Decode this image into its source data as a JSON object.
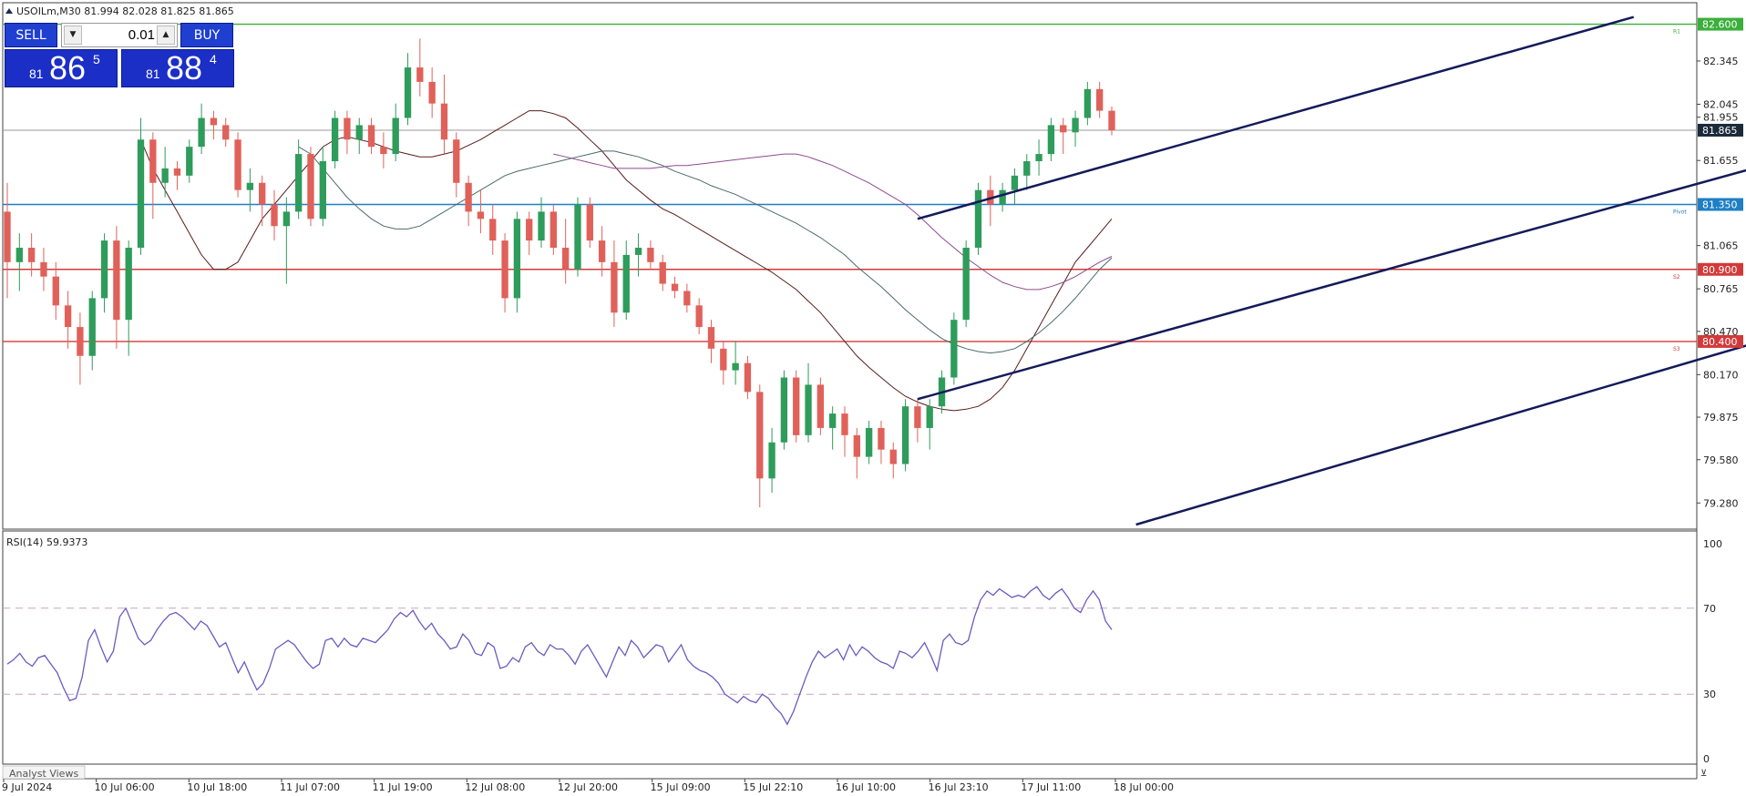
{
  "symbol_header": "USOILm,M30  81.994 82.028 81.825 81.865",
  "trade_panel": {
    "sell_label": "SELL",
    "buy_label": "BUY",
    "lot": "0.01",
    "bid": {
      "small": "81",
      "big": "86",
      "sup": "5"
    },
    "ask": {
      "small": "81",
      "big": "88",
      "sup": "4"
    }
  },
  "price_axis": {
    "min": 79.13,
    "max": 82.73,
    "ticks": [
      "82.345",
      "82.045",
      "81.955",
      "81.655",
      "81.065",
      "80.765",
      "80.470",
      "80.170",
      "79.875",
      "79.580",
      "79.280"
    ],
    "current_price": "81.865"
  },
  "levels": [
    {
      "price": 82.6,
      "label": "82.600",
      "color": "#3aaf3a",
      "tag": "R1"
    },
    {
      "price": 81.35,
      "label": "81.350",
      "color": "#1e7fc4",
      "tag": "Pivot"
    },
    {
      "price": 80.9,
      "label": "80.900",
      "color": "#d23a3a",
      "tag": "S2"
    },
    {
      "price": 80.4,
      "label": "80.400",
      "color": "#d23a3a",
      "tag": "S3"
    }
  ],
  "channel_lines": [
    {
      "x1": 75,
      "y1": 81.25,
      "x2": 134,
      "y2": 82.65
    },
    {
      "x1": 75,
      "y1": 80.0,
      "x2": 189,
      "y2": 82.65
    },
    {
      "x1": 93,
      "y1": 79.13,
      "x2": 189,
      "y2": 81.5
    }
  ],
  "time_axis": {
    "labels": [
      "9 Jul 2024",
      "10 Jul 06:00",
      "10 Jul 18:00",
      "11 Jul 07:00",
      "11 Jul 19:00",
      "12 Jul 08:00",
      "12 Jul 20:00",
      "15 Jul 09:00",
      "15 Jul 22:10",
      "16 Jul 10:00",
      "16 Jul 23:10",
      "17 Jul 11:00",
      "18 Jul 00:00"
    ]
  },
  "rsi": {
    "label": "RSI(14) 59.9373",
    "levels": [
      "100",
      "70",
      "30",
      "0"
    ],
    "color": "#6b5bbf"
  },
  "bottom_tab": "Analyst Views",
  "chart_data": {
    "type": "candlestick",
    "title": "USOILm,M30",
    "ylim": [
      79.13,
      82.73
    ],
    "candles": [
      [
        81.3,
        81.5,
        80.7,
        80.95
      ],
      [
        80.95,
        81.15,
        80.75,
        81.05
      ],
      [
        81.05,
        81.15,
        80.85,
        80.95
      ],
      [
        80.95,
        81.05,
        80.75,
        80.85
      ],
      [
        80.85,
        80.95,
        80.55,
        80.65
      ],
      [
        80.65,
        80.75,
        80.35,
        80.5
      ],
      [
        80.5,
        80.6,
        80.1,
        80.3
      ],
      [
        80.3,
        80.75,
        80.2,
        80.7
      ],
      [
        80.7,
        81.15,
        80.6,
        81.1
      ],
      [
        81.1,
        81.2,
        80.35,
        80.55
      ],
      [
        80.55,
        81.1,
        80.3,
        81.05
      ],
      [
        81.05,
        81.95,
        81.0,
        81.8
      ],
      [
        81.8,
        81.85,
        81.25,
        81.5
      ],
      [
        81.5,
        81.75,
        81.4,
        81.6
      ],
      [
        81.6,
        81.65,
        81.45,
        81.55
      ],
      [
        81.55,
        81.8,
        81.5,
        81.75
      ],
      [
        81.75,
        82.05,
        81.7,
        81.95
      ],
      [
        81.95,
        82.0,
        81.8,
        81.9
      ],
      [
        81.9,
        81.95,
        81.75,
        81.8
      ],
      [
        81.8,
        81.85,
        81.4,
        81.45
      ],
      [
        81.45,
        81.6,
        81.3,
        81.5
      ],
      [
        81.5,
        81.55,
        81.2,
        81.35
      ],
      [
        81.35,
        81.45,
        81.1,
        81.2
      ],
      [
        81.2,
        81.4,
        80.8,
        81.3
      ],
      [
        81.3,
        81.8,
        81.25,
        81.7
      ],
      [
        81.7,
        81.75,
        81.2,
        81.25
      ],
      [
        81.25,
        81.75,
        81.2,
        81.65
      ],
      [
        81.65,
        82.0,
        81.6,
        81.95
      ],
      [
        81.95,
        82.0,
        81.7,
        81.8
      ],
      [
        81.8,
        81.95,
        81.7,
        81.9
      ],
      [
        81.9,
        81.95,
        81.7,
        81.75
      ],
      [
        81.75,
        81.85,
        81.6,
        81.7
      ],
      [
        81.7,
        82.05,
        81.65,
        81.95
      ],
      [
        81.95,
        82.4,
        81.9,
        82.3
      ],
      [
        82.3,
        82.5,
        82.1,
        82.2
      ],
      [
        82.2,
        82.3,
        81.95,
        82.05
      ],
      [
        82.05,
        82.25,
        81.7,
        81.8
      ],
      [
        81.8,
        81.85,
        81.4,
        81.5
      ],
      [
        81.5,
        81.55,
        81.2,
        81.3
      ],
      [
        81.3,
        81.45,
        81.15,
        81.25
      ],
      [
        81.25,
        81.35,
        81.0,
        81.1
      ],
      [
        81.1,
        81.15,
        80.6,
        80.7
      ],
      [
        80.7,
        81.3,
        80.6,
        81.25
      ],
      [
        81.25,
        81.3,
        81.0,
        81.1
      ],
      [
        81.1,
        81.4,
        81.05,
        81.3
      ],
      [
        81.3,
        81.35,
        81.0,
        81.05
      ],
      [
        81.05,
        81.25,
        80.8,
        80.9
      ],
      [
        80.9,
        81.4,
        80.85,
        81.35
      ],
      [
        81.35,
        81.4,
        81.05,
        81.1
      ],
      [
        81.1,
        81.2,
        80.85,
        80.95
      ],
      [
        80.95,
        81.1,
        80.5,
        80.6
      ],
      [
        80.6,
        81.1,
        80.55,
        81.0
      ],
      [
        81.0,
        81.15,
        80.85,
        81.05
      ],
      [
        81.05,
        81.1,
        80.9,
        80.95
      ],
      [
        80.95,
        81.0,
        80.75,
        80.8
      ],
      [
        80.8,
        80.85,
        80.7,
        80.75
      ],
      [
        80.75,
        80.8,
        80.6,
        80.65
      ],
      [
        80.65,
        80.7,
        80.45,
        80.5
      ],
      [
        80.5,
        80.55,
        80.25,
        80.35
      ],
      [
        80.35,
        80.4,
        80.1,
        80.2
      ],
      [
        80.2,
        80.4,
        80.1,
        80.25
      ],
      [
        80.25,
        80.3,
        80.0,
        80.05
      ],
      [
        80.05,
        80.1,
        79.25,
        79.45
      ],
      [
        79.45,
        79.8,
        79.35,
        79.7
      ],
      [
        79.7,
        80.2,
        79.65,
        80.15
      ],
      [
        80.15,
        80.2,
        79.7,
        79.75
      ],
      [
        79.75,
        80.25,
        79.7,
        80.1
      ],
      [
        80.1,
        80.15,
        79.75,
        79.8
      ],
      [
        79.8,
        79.95,
        79.65,
        79.9
      ],
      [
        79.9,
        79.95,
        79.6,
        79.75
      ],
      [
        79.75,
        79.8,
        79.45,
        79.6
      ],
      [
        79.6,
        79.85,
        79.55,
        79.8
      ],
      [
        79.8,
        79.85,
        79.55,
        79.65
      ],
      [
        79.65,
        79.7,
        79.45,
        79.55
      ],
      [
        79.55,
        80.0,
        79.5,
        79.95
      ],
      [
        79.95,
        80.0,
        79.7,
        79.8
      ],
      [
        79.8,
        80.0,
        79.65,
        79.95
      ],
      [
        79.95,
        80.2,
        79.9,
        80.15
      ],
      [
        80.15,
        80.6,
        80.1,
        80.55
      ],
      [
        80.55,
        81.1,
        80.5,
        81.05
      ],
      [
        81.05,
        81.5,
        81.0,
        81.45
      ],
      [
        81.45,
        81.55,
        81.2,
        81.35
      ],
      [
        81.35,
        81.5,
        81.3,
        81.45
      ],
      [
        81.45,
        81.6,
        81.35,
        81.55
      ],
      [
        81.55,
        81.7,
        81.45,
        81.65
      ],
      [
        81.65,
        81.8,
        81.55,
        81.7
      ],
      [
        81.7,
        81.95,
        81.65,
        81.9
      ],
      [
        81.9,
        81.95,
        81.7,
        81.85
      ],
      [
        81.85,
        82.0,
        81.75,
        81.95
      ],
      [
        81.95,
        82.2,
        81.9,
        82.15
      ],
      [
        82.15,
        82.2,
        81.95,
        82.0
      ],
      [
        82.0,
        82.03,
        81.83,
        81.865
      ]
    ],
    "moving_averages": [
      {
        "color": "#5a1a1a",
        "values": [
          81.8,
          81.6,
          81.45,
          81.3,
          81.15,
          81.0,
          80.9,
          80.9,
          80.95,
          81.1,
          81.25,
          81.35,
          81.45,
          81.55,
          81.65,
          81.75,
          81.8,
          81.82,
          81.8,
          81.78,
          81.75,
          81.72,
          81.7,
          81.68,
          81.68,
          81.7,
          81.72,
          81.76,
          81.8,
          81.85,
          81.9,
          81.95,
          82.0,
          82.0,
          81.98,
          81.95,
          81.88,
          81.8,
          81.72,
          81.62,
          81.52,
          81.45,
          81.38,
          81.32,
          81.28,
          81.23,
          81.18,
          81.13,
          81.08,
          81.03,
          80.98,
          80.93,
          80.88,
          80.82,
          80.76,
          80.68,
          80.6,
          80.5,
          80.4,
          80.3,
          80.22,
          80.15,
          80.08,
          80.02,
          79.98,
          79.95,
          79.93,
          79.92,
          79.93,
          79.95,
          80.0,
          80.08,
          80.2,
          80.35,
          80.5,
          80.65,
          80.8,
          80.95,
          81.05,
          81.15,
          81.25
        ]
      },
      {
        "color": "#4a6a6a",
        "values": [
          81.75,
          81.7,
          81.6,
          81.5,
          81.4,
          81.32,
          81.25,
          81.2,
          81.18,
          81.18,
          81.2,
          81.25,
          81.3,
          81.35,
          81.4,
          81.45,
          81.5,
          81.55,
          81.58,
          81.6,
          81.62,
          81.64,
          81.66,
          81.68,
          81.7,
          81.72,
          81.72,
          81.7,
          81.68,
          81.65,
          81.62,
          81.58,
          81.55,
          81.52,
          81.48,
          81.45,
          81.42,
          81.38,
          81.34,
          81.3,
          81.26,
          81.22,
          81.17,
          81.12,
          81.06,
          81.0,
          80.92,
          80.85,
          80.78,
          80.7,
          80.62,
          80.55,
          80.48,
          80.42,
          80.38,
          80.35,
          80.33,
          80.32,
          80.33,
          80.35,
          80.4,
          80.46,
          80.53,
          80.61,
          80.7,
          80.8,
          80.9,
          80.98
        ]
      },
      {
        "color": "#8e4a8e",
        "values": [
          81.7,
          81.68,
          81.66,
          81.64,
          81.62,
          81.6,
          81.6,
          81.6,
          81.6,
          81.61,
          81.62,
          81.62,
          81.63,
          81.64,
          81.65,
          81.66,
          81.67,
          81.68,
          81.69,
          81.7,
          81.7,
          81.68,
          81.65,
          81.62,
          81.58,
          81.54,
          81.5,
          81.45,
          81.4,
          81.35,
          81.28,
          81.2,
          81.12,
          81.05,
          80.98,
          80.92,
          80.86,
          80.81,
          80.78,
          80.76,
          80.76,
          80.78,
          80.81,
          80.85,
          80.9,
          80.95,
          80.99
        ]
      }
    ],
    "rsi_values": [
      44,
      46,
      49,
      45,
      43,
      47,
      48,
      44,
      40,
      33,
      27,
      28,
      38,
      55,
      60,
      52,
      45,
      50,
      66,
      70,
      63,
      56,
      53,
      55,
      60,
      64,
      67,
      68,
      66,
      63,
      60,
      64,
      62,
      57,
      52,
      54,
      47,
      40,
      45,
      38,
      32,
      35,
      42,
      51,
      53,
      55,
      53,
      49,
      45,
      42,
      44,
      55,
      56,
      52,
      56,
      53,
      52,
      56,
      55,
      54,
      57,
      60,
      65,
      68,
      66,
      69,
      64,
      60,
      63,
      58,
      55,
      51,
      52,
      58,
      55,
      49,
      48,
      54,
      52,
      42,
      43,
      47,
      45,
      52,
      54,
      50,
      48,
      53,
      51,
      51,
      48,
      44,
      50,
      53,
      48,
      43,
      38,
      45,
      52,
      48,
      55,
      52,
      47,
      50,
      53,
      52,
      45,
      49,
      53,
      46,
      43,
      41,
      40,
      38,
      35,
      30,
      28,
      26,
      29,
      27,
      26,
      30,
      28,
      24,
      21,
      16,
      22,
      30,
      38,
      45,
      50,
      47,
      49,
      51,
      46,
      53,
      48,
      52,
      50,
      47,
      45,
      44,
      42,
      50,
      49,
      47,
      50,
      54,
      48,
      41,
      55,
      58,
      54,
      53,
      55,
      66,
      74,
      78,
      76,
      79,
      77,
      75,
      76,
      75,
      78,
      80,
      76,
      74,
      77,
      79,
      75,
      70,
      68,
      74,
      78,
      74,
      64,
      60
    ]
  }
}
